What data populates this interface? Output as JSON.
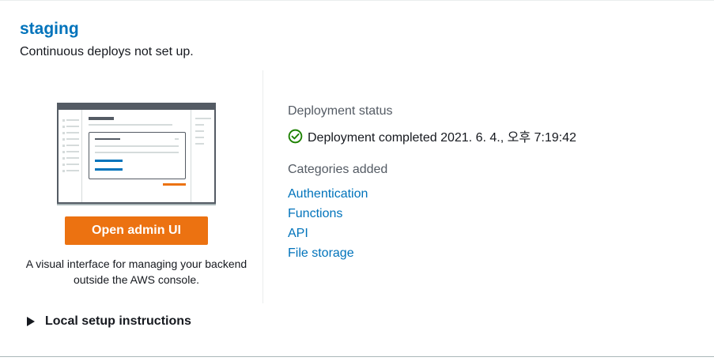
{
  "environment": {
    "name": "staging",
    "subtitle": "Continuous deploys not set up."
  },
  "admin": {
    "button_label": "Open admin UI",
    "description": "A visual interface for managing your backend outside the AWS console."
  },
  "deployment": {
    "status_label": "Deployment status",
    "status_text": "Deployment completed 2021. 6. 4., 오후 7:19:42",
    "status_icon": "success-check-icon",
    "status_color": "#1d8102"
  },
  "categories": {
    "label": "Categories added",
    "items": [
      "Authentication",
      "Functions",
      "API",
      "File storage"
    ]
  },
  "setup": {
    "label": "Local setup instructions",
    "expanded": false
  },
  "colors": {
    "link": "#0073bb",
    "primary_button": "#ec7211",
    "success": "#1d8102"
  }
}
